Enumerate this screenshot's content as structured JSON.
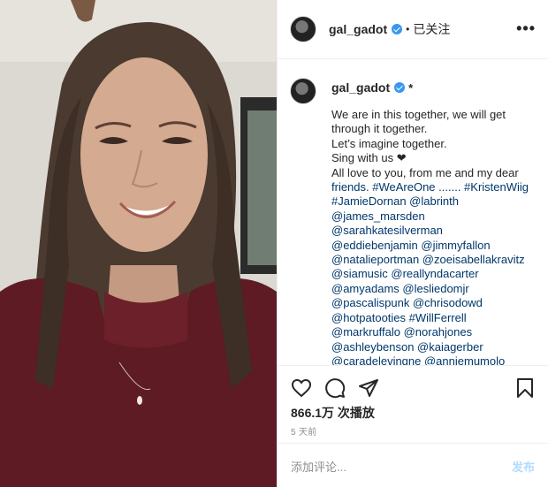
{
  "post": {
    "username": "gal_gadot",
    "dot": "•",
    "follow_label": "已关注",
    "more_label": "•••",
    "caption_marker": "*",
    "caption_lines": [
      "We are in this together, we will get",
      "through it together.",
      "Let’s imagine together.",
      "Sing with us ❤",
      "All love to you, from me and my dear",
      "friends. #WeAreOne ....... #KristenWiig",
      "#JamieDornan @labrinth",
      "@james_marsden",
      "@sarahkatesilverman",
      "@eddiebenjamin @jimmyfallon",
      "@natalieportman @zoeisabellakravitz",
      "@siamusic @reallyndacarter",
      "@amyadams @lesliedomjr",
      "@pascalispunk @chrisodowd",
      "@hotpatooties #WillFerrell",
      "@markruffalo @norahjones",
      "@ashleybenson @kaiagerber",
      "@caradelevingne @anniemumolo"
    ],
    "views": "866.1万 次播放",
    "time": "5 天前",
    "comment_placeholder": "添加评论...",
    "post_button": "发布"
  },
  "icons": [
    "heart-icon",
    "comment-icon",
    "share-icon",
    "bookmark-icon"
  ],
  "colors": {
    "link": "#00376b",
    "verified": "#3897f0",
    "muted": "#8e8e8e",
    "post_disabled": "#b3dbff"
  }
}
